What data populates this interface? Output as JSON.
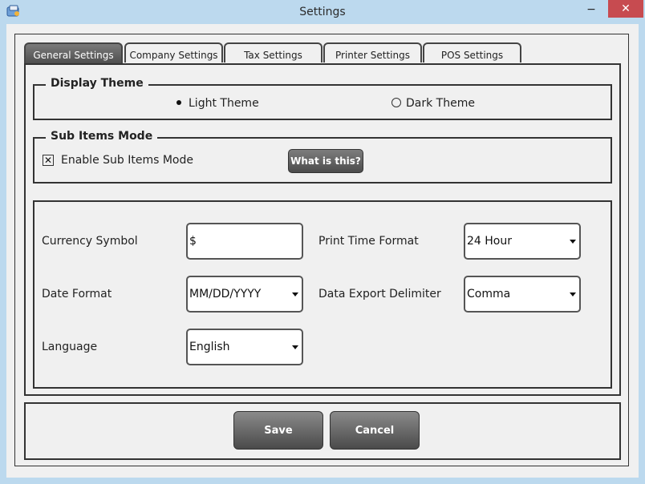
{
  "window": {
    "title": "Settings",
    "minimize_glyph": "−",
    "close_glyph": "✕"
  },
  "tabs": [
    {
      "label": "General Settings",
      "active": true
    },
    {
      "label": "Company Settings"
    },
    {
      "label": "Tax Settings"
    },
    {
      "label": "Printer Settings"
    },
    {
      "label": "POS Settings"
    }
  ],
  "display_theme": {
    "legend": "Display Theme",
    "options": [
      {
        "label": "Light Theme",
        "selected": true
      },
      {
        "label": "Dark Theme",
        "selected": false
      }
    ]
  },
  "sub_items": {
    "legend": "Sub Items Mode",
    "checkbox_label": "Enable Sub Items Mode",
    "checked": true,
    "help_button": "What is this?"
  },
  "fields": {
    "currency_symbol": {
      "label": "Currency Symbol",
      "value": "$"
    },
    "date_format": {
      "label": "Date Format",
      "value": "MM/DD/YYYY"
    },
    "language": {
      "label": "Language",
      "value": "English"
    },
    "print_time_format": {
      "label": "Print Time Format",
      "value": "24 Hour"
    },
    "data_export_delimiter": {
      "label": "Data Export Delimiter",
      "value": "Comma"
    }
  },
  "buttons": {
    "save": "Save",
    "cancel": "Cancel"
  },
  "colors": {
    "title_bar": "#bcd9ee",
    "close_button": "#c74b50",
    "dark_button": "#5a5a5a",
    "window_bg": "#f0f0f0"
  },
  "icons": {
    "app": "app-icon",
    "minimize": "minimize-icon",
    "close": "close-icon",
    "dropdown": "chevron-down-icon"
  }
}
